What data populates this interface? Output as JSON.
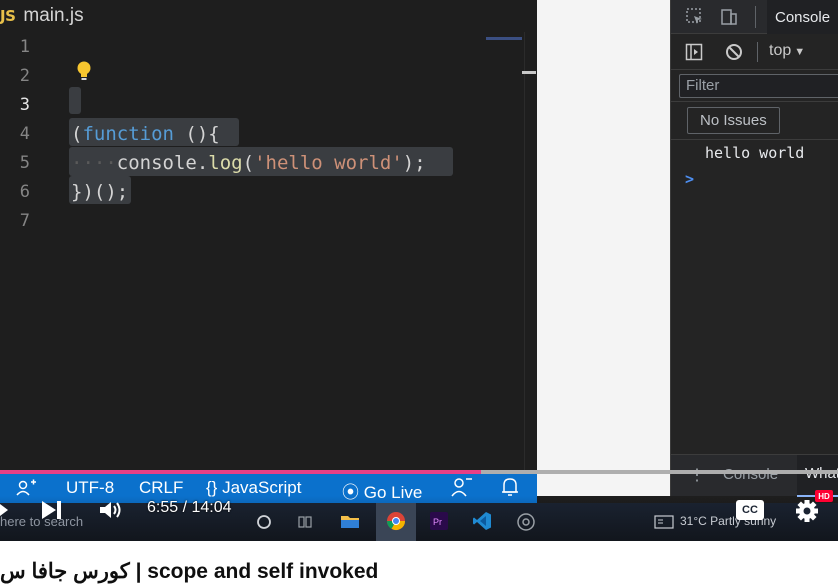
{
  "editor": {
    "tab": {
      "badge": "JS",
      "filename": "main.js"
    },
    "line_numbers": [
      "1",
      "2",
      "3",
      "4",
      "5",
      "6",
      "7"
    ],
    "active_line": "3",
    "code": {
      "line4": {
        "open_paren": "(",
        "keyword": "function",
        "rest": " (){"
      },
      "line5": {
        "indent": "····",
        "object": "console",
        "dot": ".",
        "method": "log",
        "open": "(",
        "string": "'hello world'",
        "close": ");"
      },
      "line6": {
        "text": "})();"
      }
    }
  },
  "statusbar": {
    "encoding": "UTF-8",
    "eol": "CRLF",
    "language": "{} JavaScript",
    "golive": "Go Live"
  },
  "devtools": {
    "active_tab": "Console",
    "context": "top",
    "filter_placeholder": "Filter",
    "issues": "No Issues",
    "log_output": "hello world",
    "prompt": ">",
    "drawer": {
      "tab1": "Console",
      "tab2": "What"
    }
  },
  "player": {
    "time": "6:55 / 14:04",
    "cc_label": "CC",
    "hd_badge": "HD"
  },
  "taskbar": {
    "search_text": "here to search",
    "weather": "31°C  Partly sunny"
  },
  "video": {
    "title": "كورس جافا س | scope and self invoked"
  },
  "colors": {
    "editor_bg": "#1e1e1e",
    "statusbar_bg": "#0b71cc",
    "progress_red": "#e83f86",
    "keyword": "#569cd6",
    "string": "#ce9178",
    "function": "#dcdcaa"
  }
}
